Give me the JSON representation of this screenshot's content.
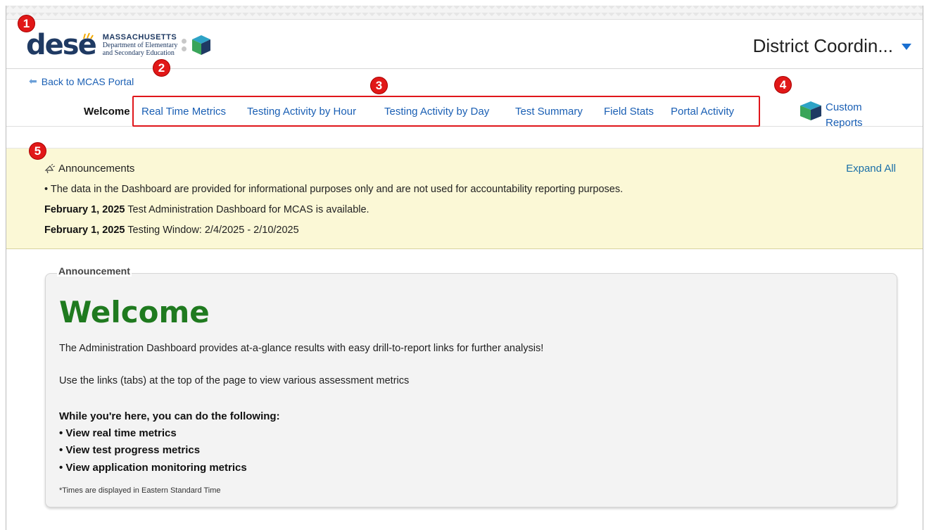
{
  "header": {
    "logo_word": "dese",
    "logo_line1": "MASSACHUSETTS",
    "logo_line2": "Department of Elementary",
    "logo_line3": "and Secondary Education",
    "user_name": "District Coordin..."
  },
  "nav": {
    "back_label": "Back to MCAS Portal",
    "welcome_label": "Welcome",
    "tabs": [
      "Real Time Metrics",
      "Testing Activity by Hour",
      "Testing Activity by Day",
      "Test Summary",
      "Field Stats",
      "Portal Activity"
    ],
    "custom_reports_label": "Custom Reports"
  },
  "announcements": {
    "title": "Announcements",
    "expand_all": "Expand All",
    "bullet": "• The data in the Dashboard are provided for informational purposes only and are not used for accountability reporting purposes.",
    "items": [
      {
        "date": "February 1, 2025",
        "text": "Test Administration Dashboard for MCAS is available."
      },
      {
        "date": "February 1, 2025",
        "text": "Testing Window: 2/4/2025 - 2/10/2025"
      }
    ]
  },
  "card": {
    "legend": "Announcement",
    "heading": "Welcome",
    "para1": "The Administration Dashboard provides at-a-glance results with easy drill-to-report links for further analysis!",
    "para2": "Use the links (tabs) at the top of the page to view various assessment metrics",
    "list_title": "While you're here, you can do the following:",
    "list": [
      "• View real time metrics",
      "• View test progress metrics",
      "• View application monitoring metrics"
    ],
    "note": "*Times are displayed in Eastern Standard Time"
  },
  "markers": [
    "1",
    "2",
    "3",
    "4",
    "5"
  ],
  "colors": {
    "accent": "#1a5fb4",
    "welcome_green": "#1f7a1f",
    "announcement_bg": "#fbf8d6",
    "marker_red": "#e11818"
  }
}
